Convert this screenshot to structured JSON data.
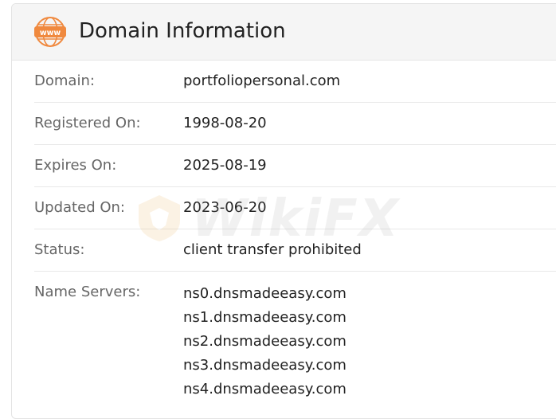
{
  "header": {
    "icon": "www-icon",
    "title": "Domain Information",
    "accent_color": "#f0893e"
  },
  "rows": [
    {
      "label": "Domain:",
      "value": "portfoliopersonal.com"
    },
    {
      "label": "Registered On:",
      "value": "1998-08-20"
    },
    {
      "label": "Expires On:",
      "value": "2025-08-19"
    },
    {
      "label": "Updated On:",
      "value": "2023-06-20"
    },
    {
      "label": "Status:",
      "value": "client transfer prohibited"
    }
  ],
  "name_servers": {
    "label": "Name Servers:",
    "values": [
      "ns0.dnsmadeeasy.com",
      "ns1.dnsmadeeasy.com",
      "ns2.dnsmadeeasy.com",
      "ns3.dnsmadeeasy.com",
      "ns4.dnsmadeeasy.com"
    ]
  },
  "watermark": {
    "text": "WikiFX",
    "icon": "wikifx-logo-icon"
  }
}
